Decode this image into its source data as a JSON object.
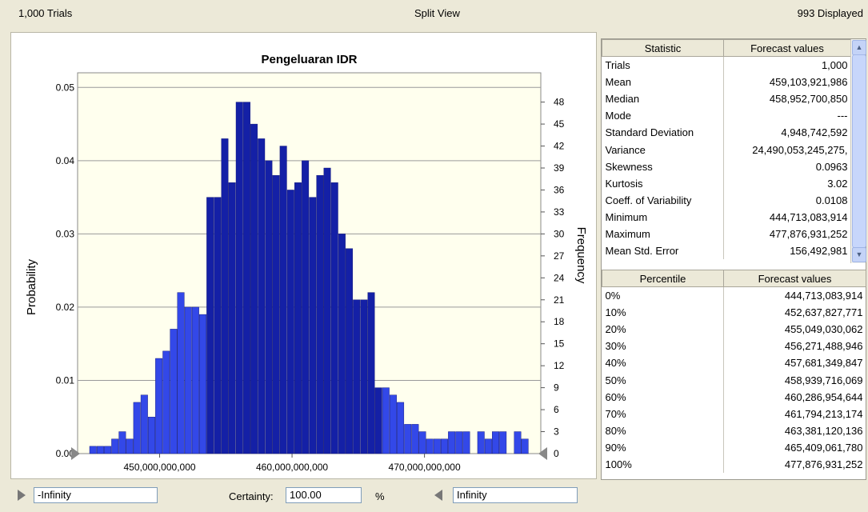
{
  "header": {
    "trials": "1,000 Trials",
    "view": "Split View",
    "displayed": "993 Displayed"
  },
  "chart_data": {
    "type": "bar",
    "title": "Pengeluaran IDR",
    "ylabel": "Probability",
    "y2label": "Frequency",
    "ylim": [
      0,
      0.052
    ],
    "y2lim": [
      0,
      52
    ],
    "yticks": [
      "0.00",
      "0.01",
      "0.02",
      "0.03",
      "0.04",
      "0.05"
    ],
    "y2ticks": [
      "0",
      "3",
      "6",
      "9",
      "12",
      "15",
      "18",
      "21",
      "24",
      "27",
      "30",
      "33",
      "36",
      "39",
      "42",
      "45",
      "48"
    ],
    "xticks": [
      "450,000,000,000",
      "460,000,000,000",
      "470,000,000,000"
    ],
    "xtick_values": [
      450000000000,
      460000000000,
      470000000000
    ],
    "xlim": [
      444713083914,
      477876931252
    ],
    "bin_start": 444713083914,
    "bin_width": 552731000,
    "frequencies": [
      1,
      1,
      1,
      2,
      3,
      2,
      7,
      8,
      5,
      13,
      14,
      17,
      22,
      20,
      20,
      19,
      35,
      35,
      43,
      37,
      48,
      48,
      45,
      43,
      40,
      38,
      42,
      36,
      37,
      40,
      35,
      38,
      39,
      37,
      30,
      28,
      21,
      21,
      22,
      9,
      9,
      8,
      7,
      4,
      4,
      3,
      2,
      2,
      2,
      3,
      3,
      3,
      0,
      3,
      2,
      3,
      3,
      0,
      3,
      2
    ],
    "central_bins": [
      16,
      39
    ],
    "colors": {
      "light": "#3348e8",
      "dark": "#1420a6",
      "plot_bg": "#ffffee",
      "grid": "#9a9a9a"
    }
  },
  "statistics": {
    "headers": [
      "Statistic",
      "Forecast values"
    ],
    "rows": [
      [
        "Trials",
        "1,000"
      ],
      [
        "Mean",
        "459,103,921,986"
      ],
      [
        "Median",
        "458,952,700,850"
      ],
      [
        "Mode",
        "---"
      ],
      [
        "Standard Deviation",
        "4,948,742,592"
      ],
      [
        "Variance",
        "24,490,053,245,275,"
      ],
      [
        "Skewness",
        "0.0963"
      ],
      [
        "Kurtosis",
        "3.02"
      ],
      [
        "Coeff. of Variability",
        "0.0108"
      ],
      [
        "Minimum",
        "444,713,083,914"
      ],
      [
        "Maximum",
        "477,876,931,252"
      ],
      [
        "Mean Std. Error",
        "156,492,981"
      ]
    ]
  },
  "percentiles": {
    "headers": [
      "Percentile",
      "Forecast values"
    ],
    "rows": [
      [
        "0%",
        "444,713,083,914"
      ],
      [
        "10%",
        "452,637,827,771"
      ],
      [
        "20%",
        "455,049,030,062"
      ],
      [
        "30%",
        "456,271,488,946"
      ],
      [
        "40%",
        "457,681,349,847"
      ],
      [
        "50%",
        "458,939,716,069"
      ],
      [
        "60%",
        "460,286,954,644"
      ],
      [
        "70%",
        "461,794,213,174"
      ],
      [
        "80%",
        "463,381,120,136"
      ],
      [
        "90%",
        "465,409,061,780"
      ],
      [
        "100%",
        "477,876,931,252"
      ]
    ]
  },
  "bottom": {
    "left_value": "-Infinity",
    "certainty_label": "Certainty:",
    "certainty_value": "100.00",
    "percent": "%",
    "right_value": "Infinity"
  },
  "icons": {
    "left_grabber": "triangle-right-icon",
    "right_grabber": "triangle-left-icon",
    "scroll_up": "chevron-up-icon",
    "scroll_down": "chevron-down-icon"
  }
}
